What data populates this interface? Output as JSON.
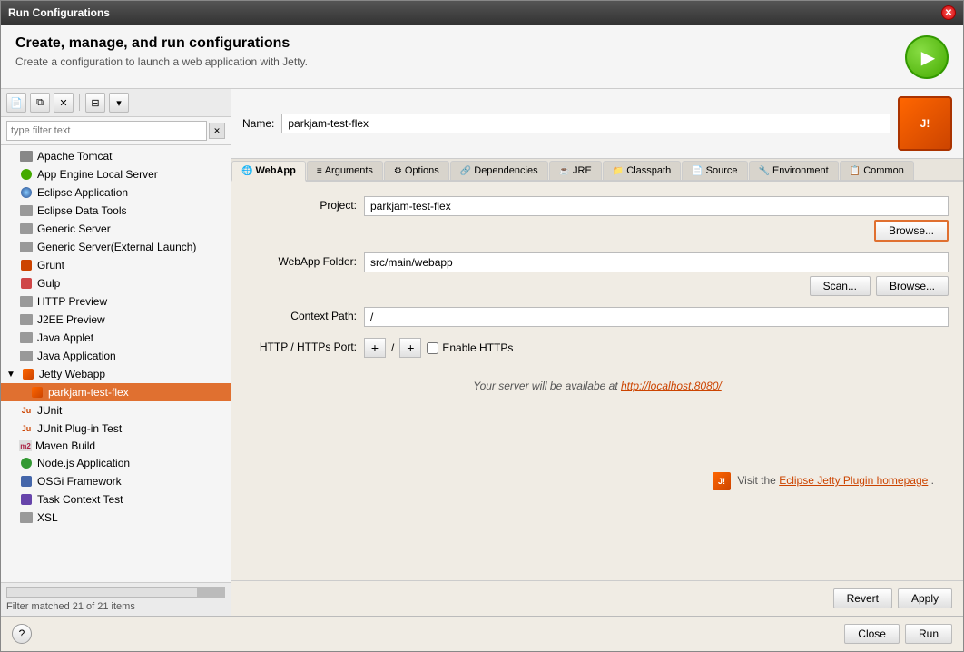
{
  "window": {
    "title": "Run Configurations"
  },
  "header": {
    "title": "Create, manage, and run configurations",
    "subtitle": "Create a configuration to launch a web application with Jetty."
  },
  "sidebar": {
    "toolbar": {
      "new_label": "+",
      "duplicate_label": "⧉",
      "delete_label": "✕",
      "collapse_label": "⊟",
      "dropdown_label": "▾"
    },
    "filter": {
      "placeholder": "type filter text"
    },
    "items": [
      {
        "label": "Apache Tomcat",
        "icon": "gray-rect",
        "level": 1
      },
      {
        "label": "App Engine Local Server",
        "icon": "green-circle",
        "level": 1
      },
      {
        "label": "Eclipse Application",
        "icon": "eclipse",
        "level": 1
      },
      {
        "label": "Eclipse Data Tools",
        "icon": "db",
        "level": 1
      },
      {
        "label": "Generic Server",
        "icon": "gray-rect",
        "level": 1
      },
      {
        "label": "Generic Server(External Launch)",
        "icon": "gray-rect",
        "level": 1
      },
      {
        "label": "Grunt",
        "icon": "grunt",
        "level": 1
      },
      {
        "label": "Gulp",
        "icon": "gulp",
        "level": 1
      },
      {
        "label": "HTTP Preview",
        "icon": "http",
        "level": 1
      },
      {
        "label": "J2EE Preview",
        "icon": "gray-rect",
        "level": 1
      },
      {
        "label": "Java Applet",
        "icon": "gray-rect",
        "level": 1
      },
      {
        "label": "Java Application",
        "icon": "gray-rect",
        "level": 1
      },
      {
        "label": "Jetty Webapp",
        "icon": "jetty",
        "level": 0,
        "expanded": true
      },
      {
        "label": "parkjam-test-flex",
        "icon": "jetty",
        "level": 1,
        "selected": true
      },
      {
        "label": "JUnit",
        "icon": "junit",
        "level": 1
      },
      {
        "label": "JUnit Plug-in Test",
        "icon": "junit",
        "level": 1
      },
      {
        "label": "Maven Build",
        "icon": "maven",
        "level": 1
      },
      {
        "label": "Node.js Application",
        "icon": "node",
        "level": 1
      },
      {
        "label": "OSGi Framework",
        "icon": "osgi",
        "level": 1
      },
      {
        "label": "Task Context Test",
        "icon": "tc",
        "level": 1
      },
      {
        "label": "XSL",
        "icon": "xsl",
        "level": 1
      }
    ],
    "footer": {
      "count": "Filter matched 21 of 21 items"
    }
  },
  "content": {
    "name_label": "Name:",
    "name_value": "parkjam-test-flex",
    "tabs": [
      {
        "label": "WebApp",
        "icon": "webapp",
        "active": true
      },
      {
        "label": "Arguments",
        "icon": "args"
      },
      {
        "label": "Options",
        "icon": "options"
      },
      {
        "label": "Dependencies",
        "icon": "deps"
      },
      {
        "label": "JRE",
        "icon": "jre"
      },
      {
        "label": "Classpath",
        "icon": "classpath"
      },
      {
        "label": "Source",
        "icon": "source"
      },
      {
        "label": "Environment",
        "icon": "environment"
      },
      {
        "label": "Common",
        "icon": "common"
      }
    ],
    "webapp": {
      "project_label": "Project:",
      "project_value": "parkjam-test-flex",
      "browse_label": "Browse...",
      "webapp_folder_label": "WebApp Folder:",
      "webapp_folder_value": "src/main/webapp",
      "scan_label": "Scan...",
      "browse2_label": "Browse...",
      "context_path_label": "Context Path:",
      "context_path_value": "/",
      "port_label": "HTTP / HTTPs Port:",
      "port_plus1_label": "+",
      "port_separator": "/",
      "port_plus2_label": "+",
      "enable_https_label": "Enable HTTPs",
      "server_info": "Your server will be availabe at",
      "server_url": "http://localhost:8080/",
      "footer_visit": "Visit the",
      "footer_link": "Eclipse Jetty Plugin homepage",
      "footer_dot": "."
    }
  },
  "buttons": {
    "revert_label": "Revert",
    "apply_label": "Apply",
    "close_label": "Close",
    "run_label": "Run"
  }
}
